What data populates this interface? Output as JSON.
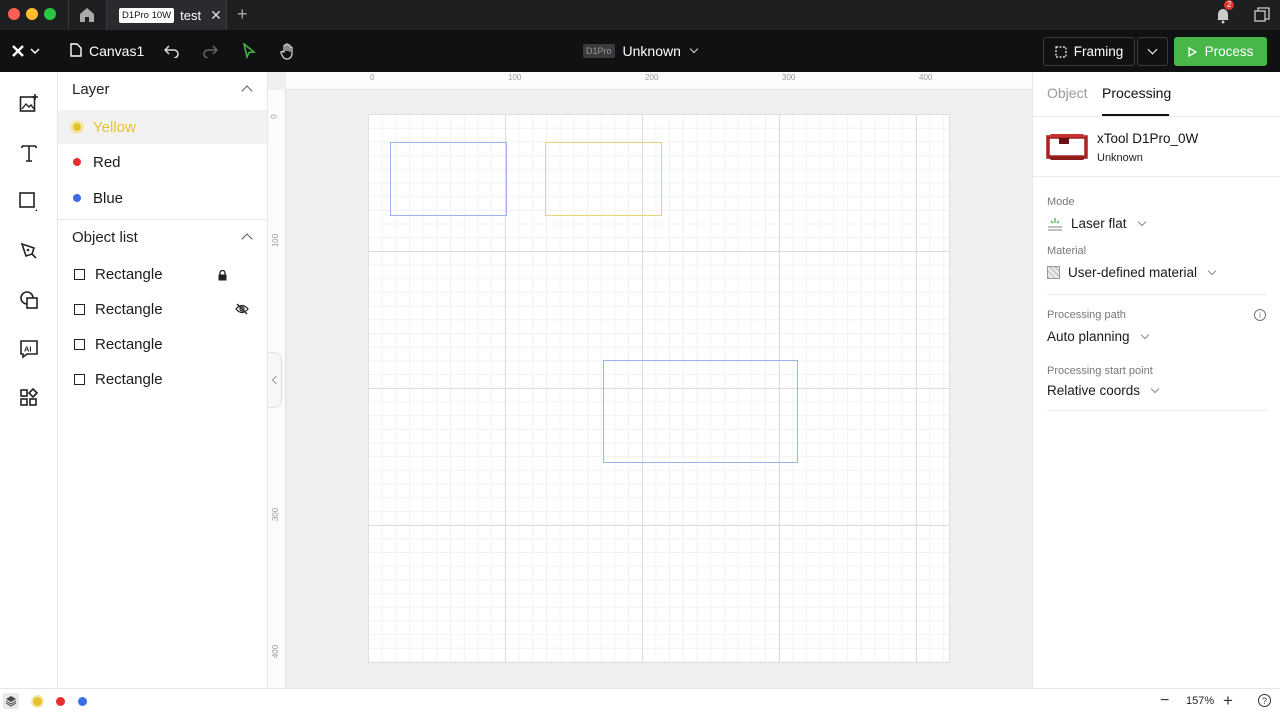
{
  "titlebar": {
    "tab_badge": "D1Pro 10W",
    "tab_title": "test",
    "notification_count": "2"
  },
  "toolbar": {
    "file_name": "Canvas1",
    "device_badge": "D1Pro",
    "device_status": "Unknown",
    "framing_label": "Framing",
    "process_label": "Process"
  },
  "left_panel": {
    "layer_title": "Layer",
    "layers": [
      {
        "label": "Yellow",
        "color": "#e6c229",
        "selected": true
      },
      {
        "label": "Red",
        "color": "#e53030",
        "selected": false
      },
      {
        "label": "Blue",
        "color": "#3a6de6",
        "selected": false
      }
    ],
    "object_list_title": "Object list",
    "objects": [
      {
        "label": "Rectangle",
        "status_icon": "lock-icon"
      },
      {
        "label": "Rectangle",
        "status_icon": "eye-off-icon"
      },
      {
        "label": "Rectangle",
        "status_icon": ""
      },
      {
        "label": "Rectangle",
        "status_icon": ""
      }
    ]
  },
  "ruler": {
    "h_ticks": [
      "0",
      "100",
      "200",
      "300",
      "400"
    ],
    "v_ticks": [
      "0",
      "100",
      "300",
      "400"
    ]
  },
  "right_panel": {
    "tabs": [
      "Object",
      "Processing"
    ],
    "active_tab": "Processing",
    "device_name": "xTool D1Pro_0W",
    "device_status": "Unknown",
    "mode_label": "Mode",
    "mode_value": "Laser flat",
    "material_label": "Material",
    "material_value": "User-defined material",
    "path_label": "Processing path",
    "path_value": "Auto planning",
    "start_label": "Processing start point",
    "start_value": "Relative coords"
  },
  "statusbar": {
    "zoom": "157%",
    "layer_colors": [
      "#e6c229",
      "#e53030",
      "#3a6de6"
    ]
  },
  "colors": {
    "accent_green": "#49b64a",
    "yellow": "#e6c229",
    "shape_blue": "#9bb5ec",
    "shape_yellow": "#ecd27a"
  }
}
